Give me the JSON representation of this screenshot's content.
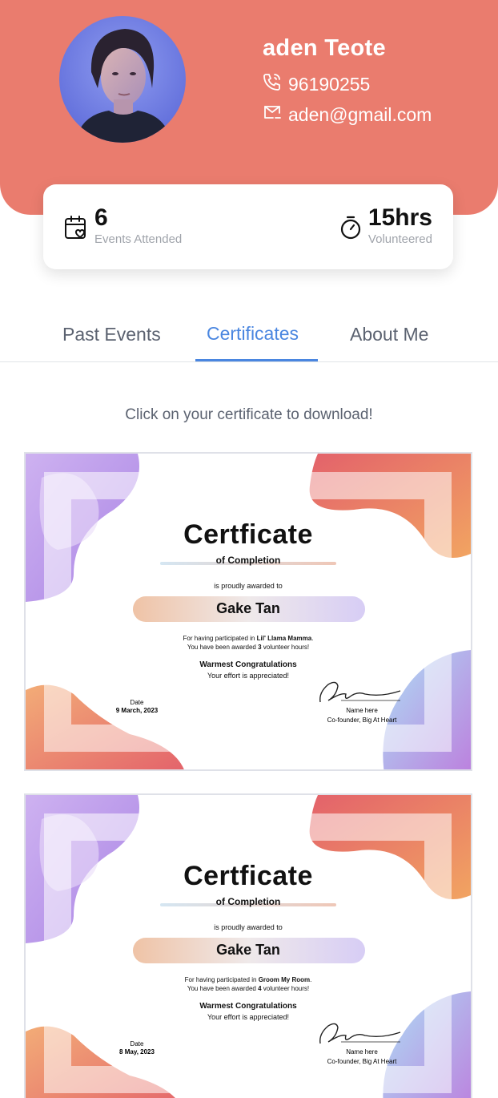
{
  "profile": {
    "name": "aden Teote",
    "phone": "96190255",
    "email": "aden@gmail.com"
  },
  "stats": {
    "events_value": "6",
    "events_label": "Events Attended",
    "hours_value": "15hrs",
    "hours_label": "Volunteered"
  },
  "tabs": [
    {
      "label": "Past Events"
    },
    {
      "label": "Certificates"
    },
    {
      "label": "About Me"
    }
  ],
  "active_tab": "Certificates",
  "hint": "Click on your certificate to download!",
  "certificates": [
    {
      "title": "Certficate",
      "subtitle": "of Completion",
      "awarded_text": "is proudly awarded to",
      "recipient": "Gake Tan",
      "line1_prefix": "For having participated in ",
      "event": "Lil' Llama Mamma",
      "line1_suffix": ".",
      "line2_prefix": "You have been awarded ",
      "hours": "3",
      "line2_suffix": " volunteer hours!",
      "congrats": "Warmest Congratulations",
      "effort": "Your effort is appreciated!",
      "date_label": "Date",
      "date": "9 March, 2023",
      "signer_name": "Name here",
      "signer_role": "Co-founder,  Big At Heart"
    },
    {
      "title": "Certficate",
      "subtitle": "of Completion",
      "awarded_text": "is proudly awarded to",
      "recipient": "Gake Tan",
      "line1_prefix": "For having participated in ",
      "event": "Groom My Room",
      "line1_suffix": ".",
      "line2_prefix": "You have been awarded ",
      "hours": "4",
      "line2_suffix": " volunteer hours!",
      "congrats": "Warmest Congratulations",
      "effort": "Your effort is appreciated!",
      "date_label": "Date",
      "date": "8 May, 2023",
      "signer_name": "Name here",
      "signer_role": "Co-founder,  Big At Heart"
    }
  ],
  "colors": {
    "header_bg": "#ea7c6e",
    "accent": "#4a86e0",
    "muted": "#a0a4ab"
  },
  "icons": {
    "phone": "phone-icon",
    "email": "mail-icon",
    "events": "calendar-heart-icon",
    "hours": "stopwatch-icon"
  }
}
